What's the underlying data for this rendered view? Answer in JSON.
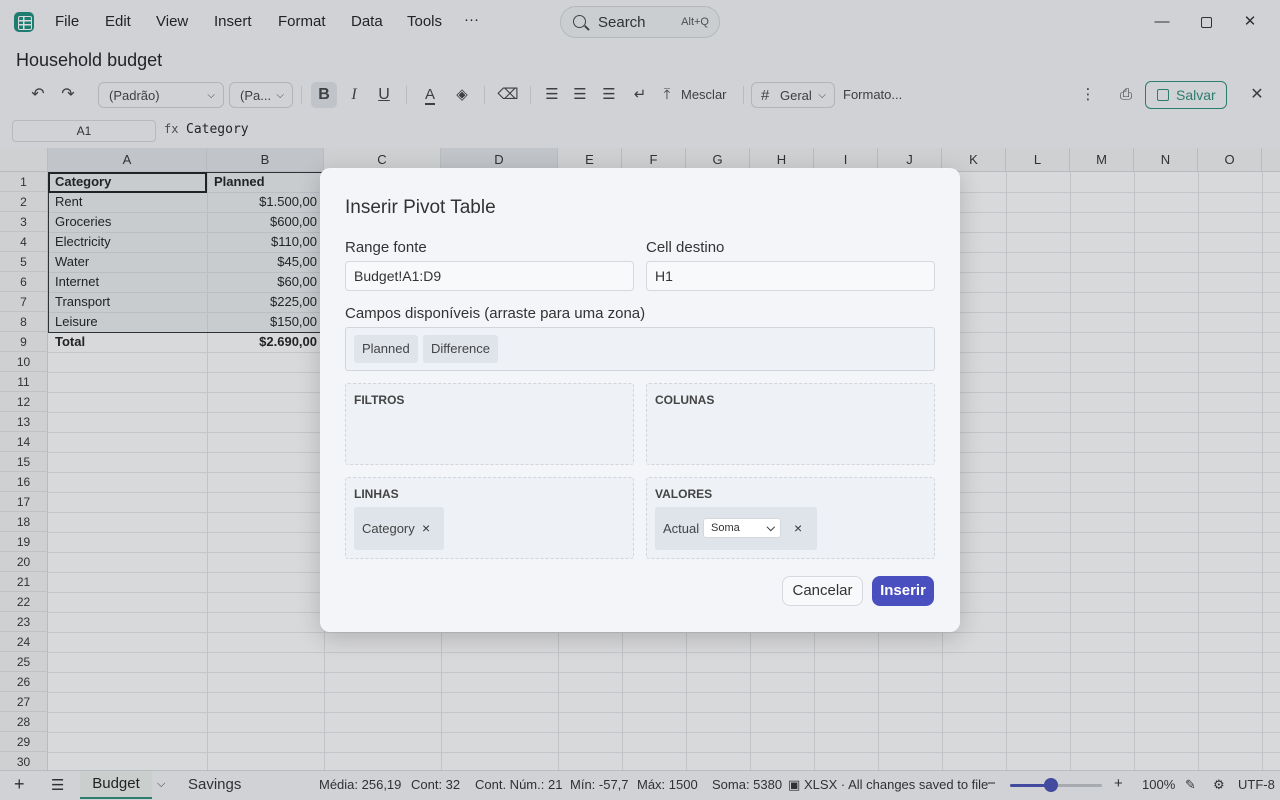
{
  "menu": {
    "items": [
      "File",
      "Edit",
      "View",
      "Insert",
      "Format",
      "Data",
      "Tools",
      "···"
    ]
  },
  "search": {
    "label": "Search",
    "shortcut": "Alt+Q"
  },
  "document": {
    "title": "Household budget"
  },
  "toolbar": {
    "undo": "↶",
    "redo": "↷",
    "font_family": "(Padrão)",
    "font_size": "(Pa...",
    "bold": "B",
    "italic": "I",
    "underline": "U",
    "merge_label": "Mesclar",
    "number_format": "Geral",
    "format_label": "Formato...",
    "save_label": "Salvar",
    "accent": "#2f8f7c"
  },
  "formula_bar": {
    "cell_ref": "A1",
    "fx": "fx",
    "value": "Category"
  },
  "grid": {
    "columns": [
      "A",
      "B",
      "C",
      "D",
      "E",
      "F",
      "G",
      "H",
      "I",
      "J",
      "K",
      "L",
      "M",
      "N",
      "O"
    ],
    "rows": [
      "1",
      "2",
      "3",
      "4",
      "5",
      "6",
      "7",
      "8",
      "9",
      "10",
      "11",
      "12",
      "13",
      "14",
      "15",
      "16",
      "17",
      "18",
      "19",
      "20",
      "21",
      "22",
      "23",
      "24",
      "25",
      "26",
      "27",
      "28",
      "29",
      "30"
    ],
    "header": {
      "a": "Category",
      "b": "Planned"
    },
    "data": [
      {
        "a": "Rent",
        "b": "$1.500,00"
      },
      {
        "a": "Groceries",
        "b": "$600,00"
      },
      {
        "a": "Electricity",
        "b": "$110,00"
      },
      {
        "a": "Water",
        "b": "$45,00"
      },
      {
        "a": "Internet",
        "b": "$60,00"
      },
      {
        "a": "Transport",
        "b": "$225,00"
      },
      {
        "a": "Leisure",
        "b": "$150,00"
      }
    ],
    "total": {
      "a": "Total",
      "b": "$2.690,00"
    }
  },
  "dialog": {
    "title": "Inserir Pivot Table",
    "source_label": "Range fonte",
    "source_value": "Budget!A1:D9",
    "dest_label": "Cell destino",
    "dest_value": "H1",
    "fields_label": "Campos disponíveis (arraste para uma zona)",
    "available_fields": [
      "Planned",
      "Difference"
    ],
    "zones": {
      "filters": "FILTROS",
      "columns": "COLUNAS",
      "rows": "LINHAS",
      "values": "VALORES"
    },
    "rows_chip": "Category",
    "values_chip": "Actual",
    "aggregation": "Soma",
    "remove": "×",
    "cancel_label": "Cancelar",
    "insert_label": "Inserir",
    "primary_color": "#4a4fbf"
  },
  "status": {
    "add": "+",
    "menu": "☰",
    "sheets": [
      "Budget",
      "Savings"
    ],
    "avg": "Média: 256,19",
    "count": "Cont: 32",
    "count_num": "Cont. Núm.: 21",
    "min": "Mín: -57,7",
    "max": "Máx: 1500",
    "sum": "Soma: 5380",
    "save_state": "XLSX · All changes saved to file",
    "zoom_minus": "−",
    "zoom_plus": "+",
    "zoom": "100%",
    "zoom_fraction": 0.45,
    "encoding": "UTF-8"
  }
}
